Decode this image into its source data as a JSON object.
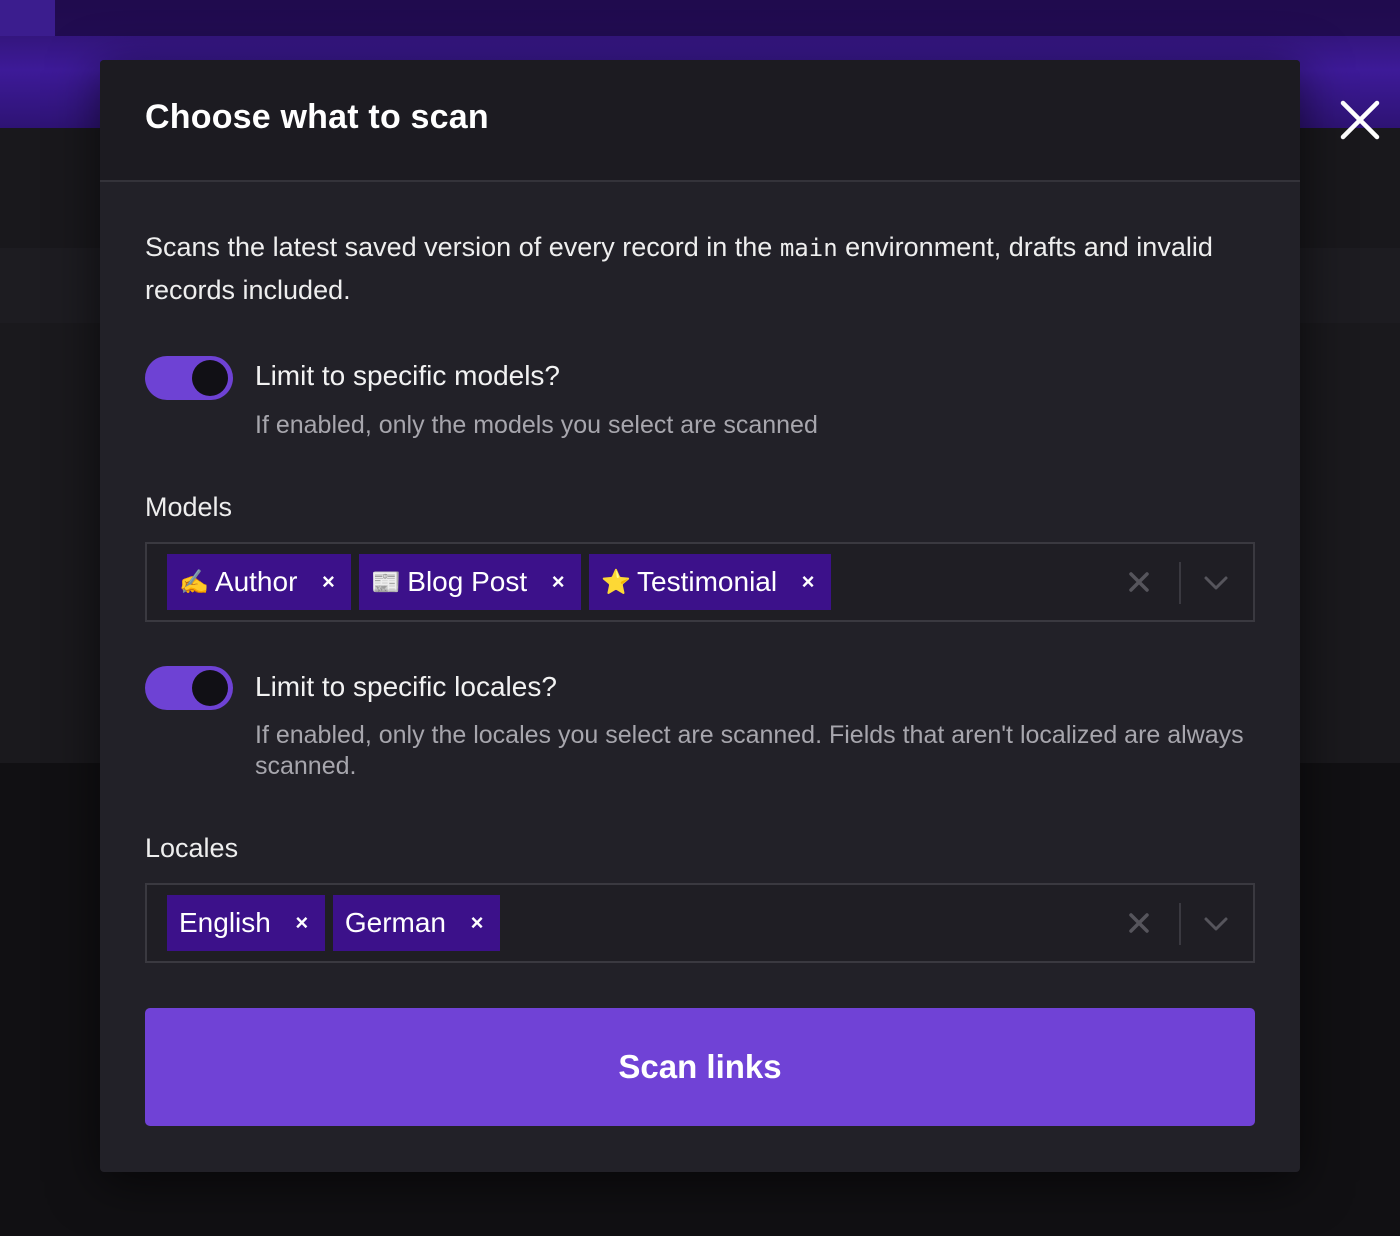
{
  "modal": {
    "title": "Choose what to scan",
    "intro_before": "Scans the latest saved version of every record in the ",
    "intro_code": "main",
    "intro_after": " environment, drafts and invalid records included."
  },
  "models_toggle": {
    "enabled": true,
    "label": "Limit to specific models?",
    "hint": "If enabled, only the models you select are scanned"
  },
  "models": {
    "label": "Models",
    "selected": [
      {
        "emoji": "✍️",
        "label": "Author",
        "remove": "×"
      },
      {
        "emoji": "📰",
        "label": "Blog Post",
        "remove": "×"
      },
      {
        "emoji": "⭐",
        "label": "Testimonial",
        "remove": "×"
      }
    ]
  },
  "locales_toggle": {
    "enabled": true,
    "label": "Limit to specific locales?",
    "hint": "If enabled, only the locales you select are scanned. Fields that aren't localized are always scanned."
  },
  "locales": {
    "label": "Locales",
    "selected": [
      {
        "label": "English",
        "remove": "×"
      },
      {
        "label": "German",
        "remove": "×"
      }
    ]
  },
  "actions": {
    "scan_label": "Scan links"
  },
  "icons": {
    "close": "close-icon",
    "clear": "clear-icon",
    "dropdown": "chevron-down-icon"
  },
  "colors": {
    "accent": "#7042d6",
    "chip": "#3c118a",
    "modal_bg": "#222128",
    "header_bg": "#1c1b21"
  }
}
